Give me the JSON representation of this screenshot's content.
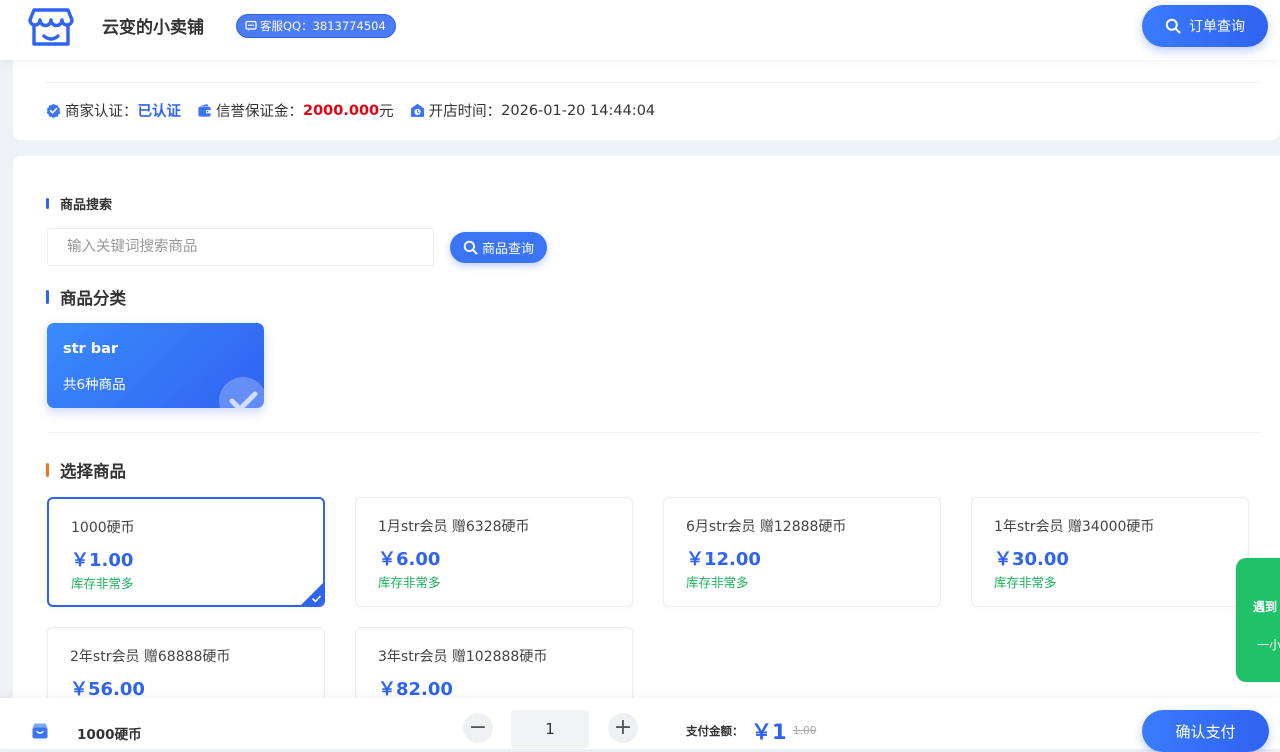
{
  "header": {
    "shop_name": "云变的小卖铺",
    "qq_label": "客服QQ：3813774504",
    "order_query_label": "订单查询"
  },
  "info": {
    "merchant_label": "商家认证：",
    "merchant_value": "已认证",
    "deposit_label": "信誉保证金：",
    "deposit_value": "2000.000",
    "deposit_unit": "元",
    "open_time_label": "开店时间：",
    "open_time_value": "2026-01-20 14:44:04"
  },
  "search": {
    "section_title": "商品搜索",
    "placeholder": "输入关键词搜索商品",
    "button_label": "商品查询"
  },
  "category": {
    "section_title": "商品分类",
    "items": [
      {
        "name": "str bar",
        "count_label": "共6种商品"
      }
    ]
  },
  "products": {
    "section_title": "选择商品",
    "items": [
      {
        "name": "1000硬币",
        "price": "￥1.00",
        "stock": "库存非常多",
        "selected": true
      },
      {
        "name": "1月str会员 赠6328硬币",
        "price": "￥6.00",
        "stock": "库存非常多"
      },
      {
        "name": "6月str会员 赠12888硬币",
        "price": "￥12.00",
        "stock": "库存非常多"
      },
      {
        "name": "1年str会员 赠34000硬币",
        "price": "￥30.00",
        "stock": "库存非常多"
      },
      {
        "name": "2年str会员 赠68888硬币",
        "price": "￥56.00",
        "stock": ""
      },
      {
        "name": "3年str会员 赠102888硬币",
        "price": "￥82.00",
        "stock": ""
      }
    ]
  },
  "side_float": {
    "line1": "遇到",
    "line2": "一小"
  },
  "checkout": {
    "product_name": "1000硬币",
    "minus": "−",
    "quantity": "1",
    "plus": "+",
    "pay_label": "支付金额：",
    "pay_amount": "￥1",
    "original_price": "1.00",
    "confirm_label": "确认支付"
  },
  "colors": {
    "primary": "#2f63f0",
    "danger": "#e60012",
    "stock_green": "#19b35a",
    "accent_orange": "#f5761a"
  }
}
